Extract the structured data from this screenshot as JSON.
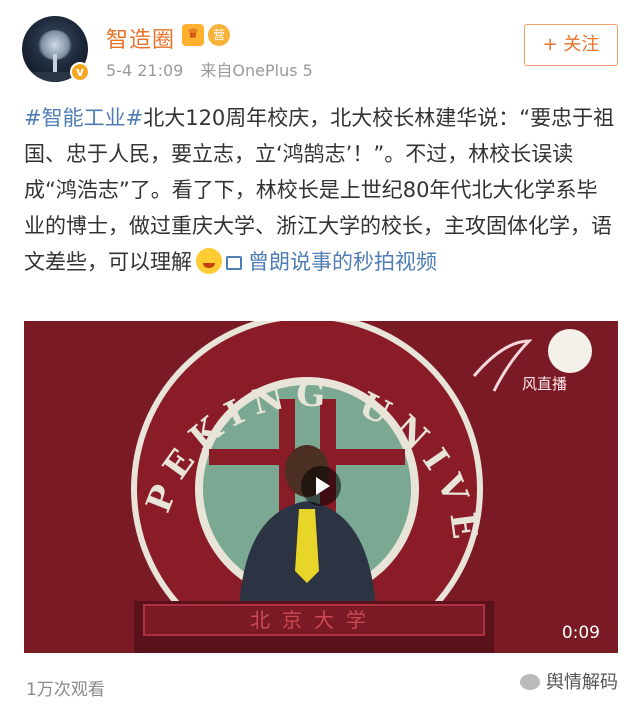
{
  "user": {
    "name": "智造圈",
    "level_badge": "营",
    "verified_mark": "v"
  },
  "meta": {
    "date": "5-4 21:09",
    "source": "来自OnePlus 5"
  },
  "follow_button": {
    "label": "+ 关注"
  },
  "post": {
    "hashtag": "#智能工业#",
    "text": "北大120周年校庆，北大校长林建华说：“要忠于祖国、忠于人民，要立志，立‘鸿鹄志’！”。不过，林校长误读成“鸿浩志”了。看了下，林校长是上世纪80年代北大化学系毕业的博士，做过重庆大学、浙江大学的校长，主攻固体化学，语文差些，可以理解",
    "video_link": "曾朗说事的秒拍视频"
  },
  "video": {
    "seal_text": "PEKING UNIVERSITY",
    "podium_text": "北京大学",
    "watermark": "风直播",
    "duration": "0:09",
    "play_icon": "play-icon"
  },
  "views": "1万次观看",
  "footer": {
    "brand": "舆情解码"
  },
  "colors": {
    "username": "#e8732a",
    "link": "#4f7db4",
    "video_bg": "#7a1a24"
  }
}
